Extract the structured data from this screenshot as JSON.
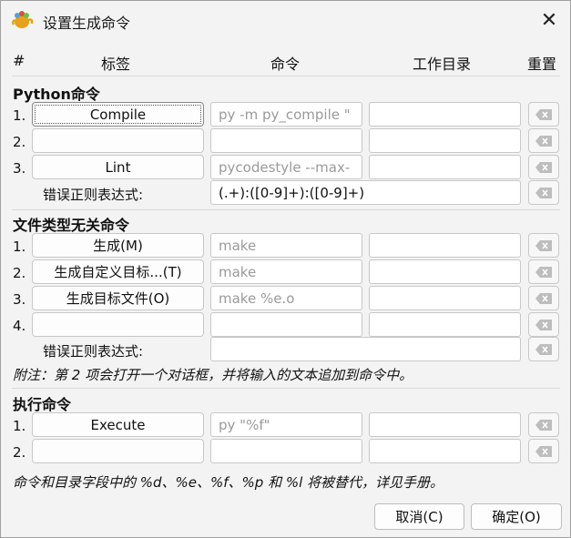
{
  "window": {
    "title": "设置生成命令"
  },
  "columns": {
    "num": "#",
    "label": "标签",
    "command": "命令",
    "workdir": "工作目录",
    "reset": "重置"
  },
  "python": {
    "heading": "Python命令",
    "rows": [
      {
        "num": "1.",
        "label": "Compile",
        "command": "py -m py_compile \"",
        "dir": ""
      },
      {
        "num": "2.",
        "label": "",
        "command": "",
        "dir": ""
      },
      {
        "num": "3.",
        "label": "Lint",
        "command": "pycodestyle --max-",
        "dir": ""
      }
    ],
    "regex_label": "错误正则表达式:",
    "regex_value": "(.+):([0-9]+):([0-9]+)"
  },
  "independent": {
    "heading": "文件类型无关命令",
    "rows": [
      {
        "num": "1.",
        "label": "生成(M)",
        "command": "make",
        "dir": ""
      },
      {
        "num": "2.",
        "label": "生成自定义目标...(T)",
        "command": "make",
        "dir": ""
      },
      {
        "num": "3.",
        "label": "生成目标文件(O)",
        "command": "make %e.o",
        "dir": ""
      },
      {
        "num": "4.",
        "label": "",
        "command": "",
        "dir": ""
      }
    ],
    "regex_label": "错误正则表达式:",
    "regex_value": "",
    "note": "附注：第 2 项会打开一个对话框，并将输入的文本追加到命令中。"
  },
  "execute": {
    "heading": "执行命令",
    "rows": [
      {
        "num": "1.",
        "label": "Execute",
        "command": "py \"%f\"",
        "dir": ""
      },
      {
        "num": "2.",
        "label": "",
        "command": "",
        "dir": ""
      }
    ]
  },
  "footer_note": "命令和目录字段中的 %d、%e、%f、%p 和 %l 将被替代，详见手册。",
  "buttons": {
    "cancel": "取消(C)",
    "ok": "确定(O)"
  },
  "icons": {
    "app": "geany-teapot-icon",
    "close": "close-icon",
    "clear": "clear-backspace-icon"
  }
}
